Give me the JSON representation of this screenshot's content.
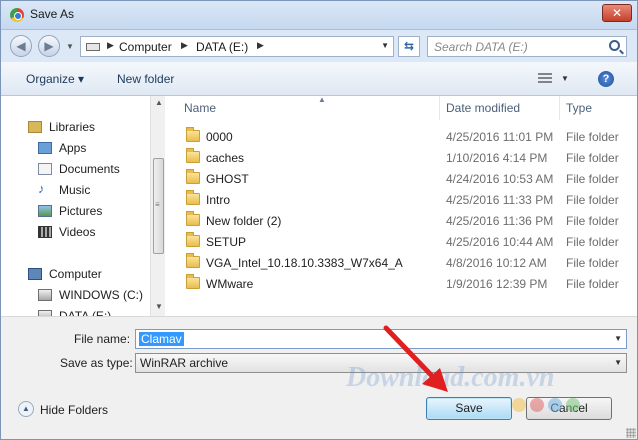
{
  "window": {
    "title": "Save As",
    "close_label": "✕"
  },
  "nav": {
    "back_glyph": "◀",
    "forward_glyph": "▶",
    "breadcrumb": [
      "Computer",
      "DATA (E:)"
    ],
    "crumb_separator": "▶",
    "search_placeholder": "Search DATA (E:)",
    "refresh_glyph": "⇆"
  },
  "toolbar": {
    "organize": "Organize ▾",
    "new_folder": "New folder",
    "help": "?"
  },
  "sidebar": {
    "items": [
      {
        "label": "Libraries",
        "icon": "libraries-icon"
      },
      {
        "label": "Apps",
        "icon": "apps-icon"
      },
      {
        "label": "Documents",
        "icon": "documents-icon"
      },
      {
        "label": "Music",
        "icon": "music-icon"
      },
      {
        "label": "Pictures",
        "icon": "pictures-icon"
      },
      {
        "label": "Videos",
        "icon": "videos-icon"
      },
      {
        "label": "Computer",
        "icon": "computer-icon"
      },
      {
        "label": "WINDOWS (C:)",
        "icon": "drive-icon"
      },
      {
        "label": "DATA (E:)",
        "icon": "drive-icon"
      }
    ]
  },
  "file_list": {
    "columns": [
      "Name",
      "Date modified",
      "Type"
    ],
    "rows": [
      {
        "name": "0000",
        "date": "4/25/2016 11:01 PM",
        "type": "File folder"
      },
      {
        "name": "caches",
        "date": "1/10/2016 4:14 PM",
        "type": "File folder"
      },
      {
        "name": "GHOST",
        "date": "4/24/2016 10:53 AM",
        "type": "File folder"
      },
      {
        "name": "Intro",
        "date": "4/25/2016 11:33 PM",
        "type": "File folder"
      },
      {
        "name": "New folder (2)",
        "date": "4/25/2016 11:36 PM",
        "type": "File folder"
      },
      {
        "name": "SETUP",
        "date": "4/25/2016 10:44 AM",
        "type": "File folder"
      },
      {
        "name": "VGA_Intel_10.18.10.3383_W7x64_A",
        "date": "4/8/2016 10:12 AM",
        "type": "File folder"
      },
      {
        "name": "WMware",
        "date": "1/9/2016 12:39 PM",
        "type": "File folder"
      }
    ]
  },
  "form": {
    "filename_label": "File name:",
    "filename_value": "Clamav",
    "savetype_label": "Save as type:",
    "savetype_value": "WinRAR archive",
    "hide_folders": "Hide Folders",
    "save": "Save",
    "cancel": "Cancel"
  },
  "watermark": {
    "text": "Download.com.vn"
  },
  "colors": {
    "accent": "#3399ff",
    "arrow": "#e02020",
    "title_bar": "#c5d8ef"
  }
}
